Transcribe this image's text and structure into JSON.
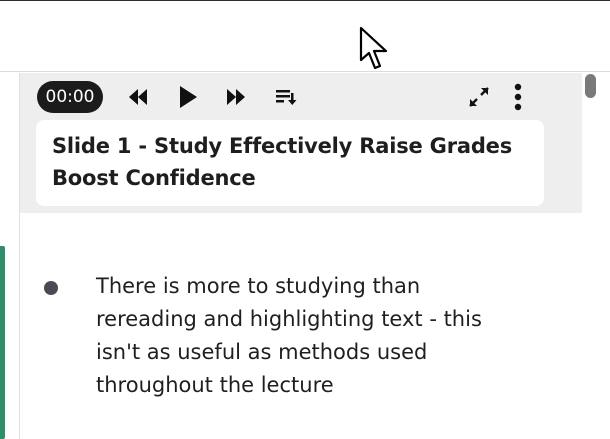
{
  "player": {
    "time": "00:00",
    "controls": [
      "rewind-icon",
      "play-icon",
      "fast-forward-icon",
      "playlist-icon",
      "fullscreen-icon",
      "more-options-icon"
    ]
  },
  "slide": {
    "title": "Slide 1 - Study Effectively Raise Grades Boost Confidence"
  },
  "bullets": [
    {
      "text": "There is more to studying than rereading and highlighting text - this isn't as useful as methods used throughout the lecture"
    }
  ],
  "colors": {
    "accent_green": "#2f8f6a",
    "time_pill": "#1b1b1b",
    "player_bg": "#eeeeee"
  }
}
